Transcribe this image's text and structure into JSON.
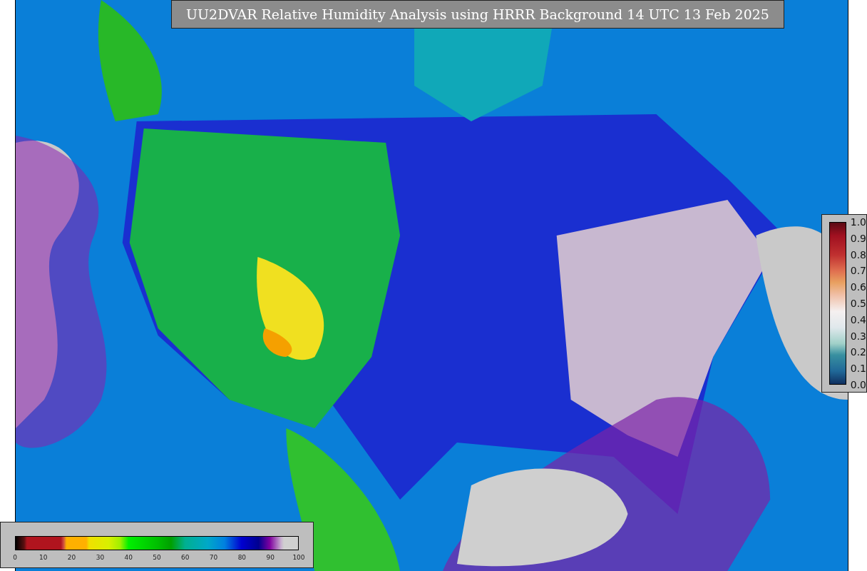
{
  "title": "UU2DVAR Relative Humidity Analysis using HRRR Background 14 UTC 13 Feb 2025",
  "humidity_colorbar": {
    "ticks": [
      "0",
      "10",
      "20",
      "30",
      "40",
      "50",
      "60",
      "70",
      "80",
      "90",
      "100"
    ]
  },
  "station_colorbar": {
    "ticks": [
      "1.0",
      "0.9",
      "0.8",
      "0.7",
      "0.6",
      "0.5",
      "0.4",
      "0.3",
      "0.2",
      "0.1",
      "0.0"
    ]
  }
}
